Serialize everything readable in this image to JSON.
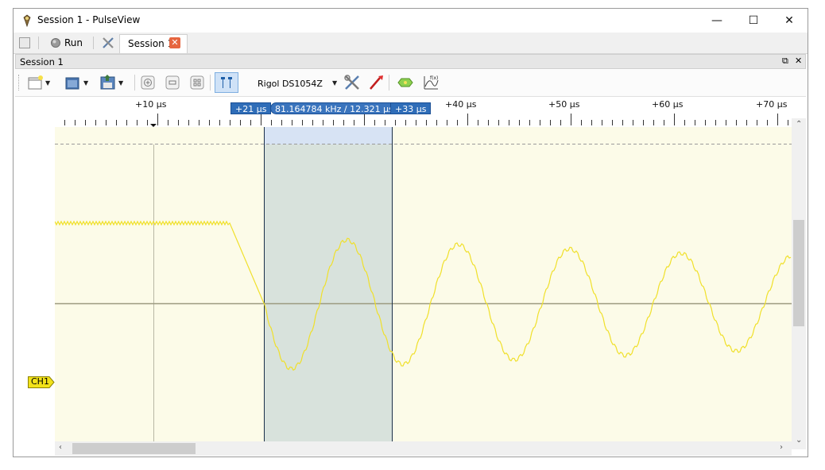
{
  "window": {
    "title": "Session 1 - PulseView",
    "controls": {
      "minimize": "—",
      "maximize": "☐",
      "close": "✕"
    }
  },
  "tabbar": {
    "run_label": "Run",
    "tab_label": "Session 1",
    "tab_close": "✕"
  },
  "session_dock": {
    "title": "Session 1",
    "float_icon": "⧉",
    "close_icon": "✕"
  },
  "toolbar": {
    "device": "Rigol DS1054Z",
    "icons": [
      "new-session-icon",
      "open-file-icon",
      "save-file-icon",
      "zoom-in-icon",
      "zoom-out-icon",
      "zoom-fit-icon",
      "cursors-icon",
      "device-config-icon",
      "trigger-probe-icon",
      "add-decoder-icon",
      "add-math-icon"
    ]
  },
  "ruler": {
    "ticks": [
      {
        "label": "+10 µs"
      },
      {
        "label": "+40 µs"
      },
      {
        "label": "+50 µs"
      },
      {
        "label": "+60 µs"
      },
      {
        "label": "+70 µs"
      }
    ],
    "cursor_left": "+21 µs",
    "cursor_right": "+33 µs",
    "cursor_measure": "81.164784 kHz / 12.321 µs"
  },
  "channel": {
    "name": "CH1",
    "color": "#f2e21a"
  },
  "colors": {
    "cursor_fill": "#d7e3f4",
    "trace": "#f0e02a",
    "viewport_bg": "#fcfbe8",
    "flag_blue": "#2f6db8"
  }
}
